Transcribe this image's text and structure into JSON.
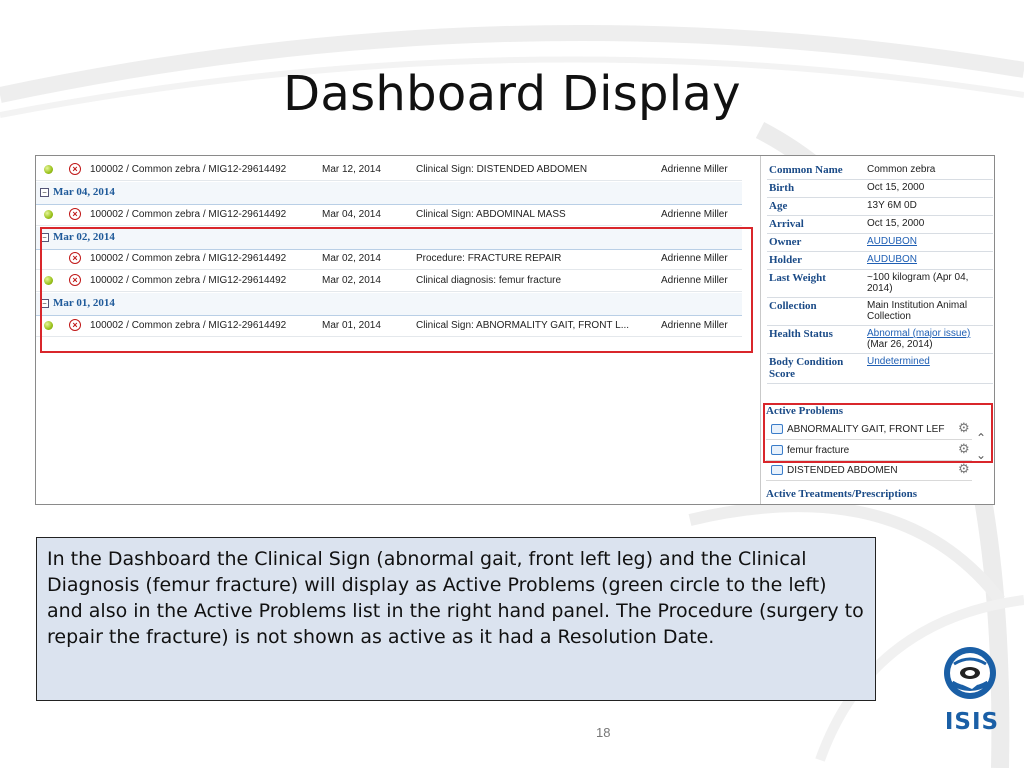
{
  "slide": {
    "title": "Dashboard Display",
    "page_number": "18"
  },
  "left_panel": {
    "rows": [
      {
        "type": "data",
        "active": true,
        "animal": "100002 / Common zebra / MIG12-29614492",
        "date": "Mar 12, 2014",
        "description": "Clinical Sign: DISTENDED ABDOMEN",
        "user": "Adrienne Miller"
      },
      {
        "type": "group",
        "label": "Mar 04, 2014"
      },
      {
        "type": "data",
        "active": true,
        "animal": "100002 / Common zebra / MIG12-29614492",
        "date": "Mar 04, 2014",
        "description": "Clinical Sign: ABDOMINAL MASS",
        "user": "Adrienne Miller"
      },
      {
        "type": "group",
        "label": "Mar 02, 2014"
      },
      {
        "type": "data",
        "active": false,
        "animal": "100002 / Common zebra / MIG12-29614492",
        "date": "Mar 02, 2014",
        "description": "Procedure: FRACTURE REPAIR",
        "user": "Adrienne Miller"
      },
      {
        "type": "data",
        "active": true,
        "animal": "100002 / Common zebra / MIG12-29614492",
        "date": "Mar 02, 2014",
        "description": "Clinical diagnosis: femur fracture",
        "user": "Adrienne Miller"
      },
      {
        "type": "group",
        "label": "Mar 01, 2014"
      },
      {
        "type": "data",
        "active": true,
        "animal": "100002 / Common zebra / MIG12-29614492",
        "date": "Mar 01, 2014",
        "description": "Clinical Sign: ABNORMALITY GAIT, FRONT L...",
        "user": "Adrienne Miller"
      }
    ]
  },
  "right_panel": {
    "fields": [
      {
        "key": "Common Name",
        "value": "Common zebra",
        "link": false
      },
      {
        "key": "Birth",
        "value": "Oct 15, 2000",
        "link": false
      },
      {
        "key": "Age",
        "value": "13Y 6M 0D",
        "link": false
      },
      {
        "key": "Arrival",
        "value": "Oct 15, 2000",
        "link": false
      },
      {
        "key": "Owner",
        "value": "AUDUBON",
        "link": true
      },
      {
        "key": "Holder",
        "value": "AUDUBON",
        "link": true
      },
      {
        "key": "Last Weight",
        "value": "~100 kilogram (Apr 04, 2014)",
        "link": false
      },
      {
        "key": "Collection",
        "value": "Main Institution Animal Collection",
        "link": false
      }
    ],
    "health_status": {
      "key": "Health Status",
      "link_text": "Abnormal (major issue)",
      "suffix": " (Mar 26, 2014)"
    },
    "body_condition": {
      "key": "Body Condition Score",
      "value": "Undetermined"
    },
    "active_problems": {
      "header": "Active Problems",
      "items": [
        "ABNORMALITY GAIT, FRONT LEF",
        "femur fracture",
        "DISTENDED ABDOMEN"
      ]
    },
    "active_treatments_header": "Active Treatments/Prescriptions"
  },
  "caption": "In the Dashboard the Clinical Sign (abnormal gait, front left leg) and the Clinical Diagnosis (femur fracture) will display as Active Problems (green circle to the left) and also in the Active Problems list in the right hand panel. The Procedure (surgery to repair the fracture) is not shown as active as it had a Resolution Date.",
  "logo": {
    "text": "ISIS"
  },
  "colors": {
    "highlight_box": "#d9262b",
    "caption_bg": "#dbe3ef",
    "link": "#1f5fb4",
    "logo_blue": "#1a5fa6"
  }
}
